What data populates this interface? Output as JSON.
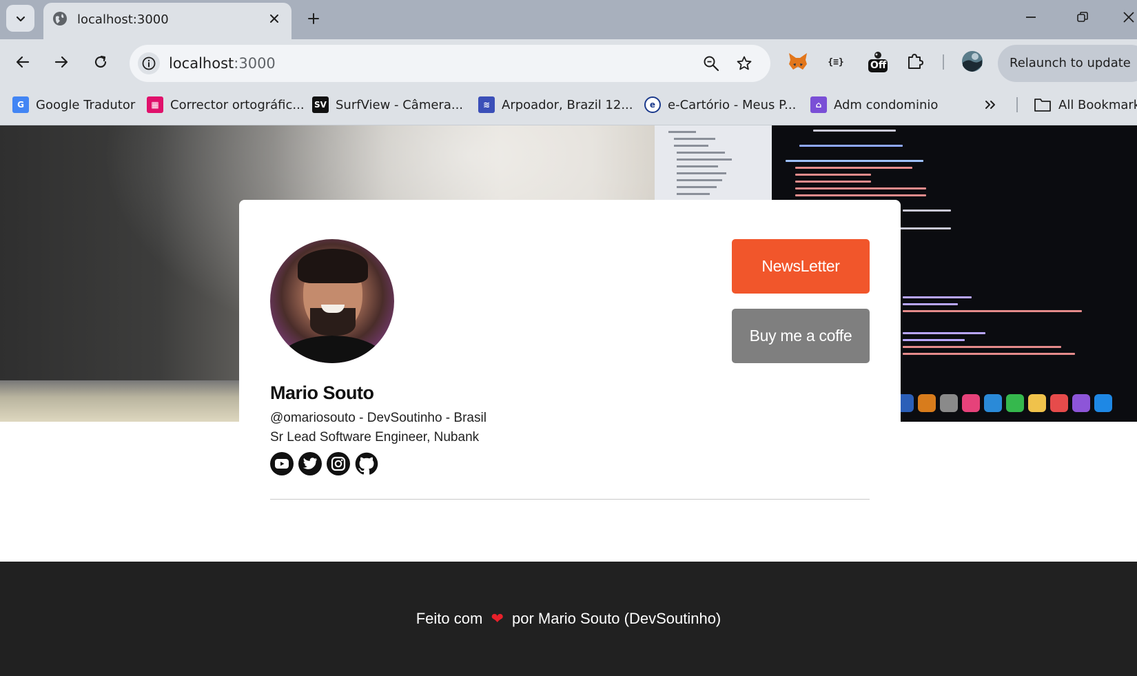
{
  "browser": {
    "tab": {
      "title": "localhost:3000"
    },
    "address_bar": {
      "host": "localhost",
      "port": ":3000"
    },
    "relaunch_label": "Relaunch to update",
    "extension_badge": "Off",
    "bookmarks": [
      {
        "label": "Google Tradutor",
        "icon": "google-translate-icon",
        "color": "#4285f4"
      },
      {
        "label": "Corrector ortográfic...",
        "icon": "corrector-icon",
        "color": "#e0116b"
      },
      {
        "label": "SurfView - Câmera...",
        "icon": "surfview-icon",
        "color": "#111111"
      },
      {
        "label": "Arpoador, Brazil 12...",
        "icon": "arpoador-icon",
        "color": "#3b4fb8"
      },
      {
        "label": "e-Cartório - Meus P...",
        "icon": "ecartorio-icon",
        "color": "#1b3a8c"
      },
      {
        "label": "Adm condominio",
        "icon": "condominio-icon",
        "color": "#7a4fd6"
      }
    ],
    "all_bookmarks_label": "All Bookmark"
  },
  "profile": {
    "name": "Mario Souto",
    "handle_line": "@omariosouto - DevSoutinho - Brasil",
    "role_line": "Sr Lead Software Engineer, Nubank",
    "socials": [
      "youtube-icon",
      "twitter-icon",
      "instagram-icon",
      "github-icon"
    ]
  },
  "actions": {
    "newsletter_label": "NewsLetter",
    "newsletter_color": "#f1562b",
    "coffee_label": "Buy me a coffe",
    "coffee_color": "#7f7f7f"
  },
  "footer": {
    "prefix": "Feito com",
    "suffix": "por Mario Souto (DevSoutinho)",
    "heart": "❤"
  }
}
